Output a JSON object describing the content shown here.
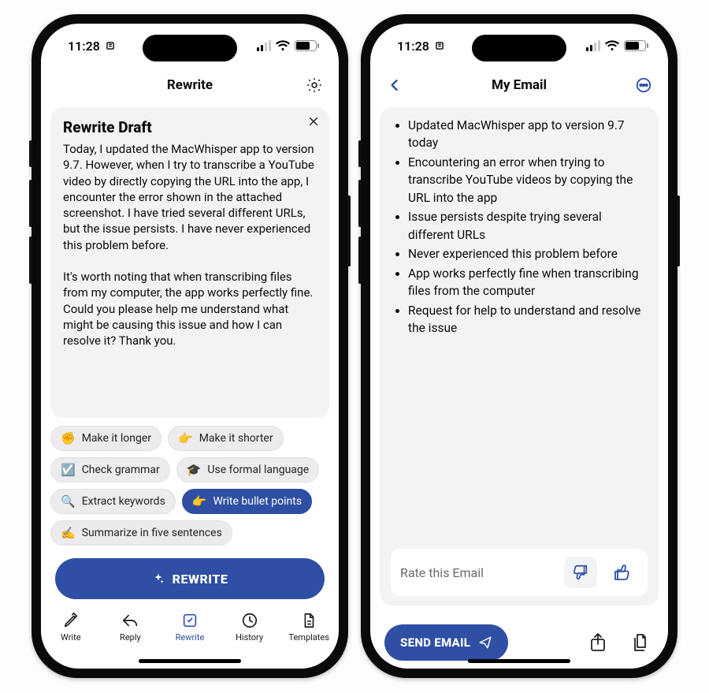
{
  "status": {
    "time": "11:28",
    "clock_icon": "⏱"
  },
  "left": {
    "nav_title": "Rewrite",
    "card_title": "Rewrite Draft",
    "draft_text": "Today, I updated the MacWhisper app to version 9.7. However, when I try to transcribe a YouTube video by directly copying the URL into the app, I encounter the error shown in the attached screenshot. I have tried several different URLs, but the issue persists. I have never experienced this problem before.\n\nIt's worth noting that when transcribing files from my computer, the app works perfectly fine. Could you please help me understand what might be causing this issue and how I can resolve it? Thank you.",
    "chips": [
      {
        "emoji": "✊",
        "label": "Make it longer",
        "selected": false
      },
      {
        "emoji": "👉",
        "label": "Make it shorter",
        "selected": false
      },
      {
        "emoji": "☑️",
        "label": "Check grammar",
        "selected": false
      },
      {
        "emoji": "🎓",
        "label": "Use formal language",
        "selected": false
      },
      {
        "emoji": "🔍",
        "label": "Extract keywords",
        "selected": false
      },
      {
        "emoji": "👉",
        "label": "Write bullet points",
        "selected": true
      },
      {
        "emoji": "✍️",
        "label": "Summarize in five sentences",
        "selected": false
      }
    ],
    "rewrite_button": "REWRITE",
    "tabs": [
      {
        "key": "write",
        "label": "Write",
        "active": false
      },
      {
        "key": "reply",
        "label": "Reply",
        "active": false
      },
      {
        "key": "rewrite",
        "label": "Rewrite",
        "active": true
      },
      {
        "key": "history",
        "label": "History",
        "active": false
      },
      {
        "key": "templates",
        "label": "Templates",
        "active": false
      }
    ]
  },
  "right": {
    "nav_title": "My Email",
    "bullets": [
      "Updated MacWhisper app to version 9.7 today",
      "Encountering an error when trying to transcribe YouTube videos by copying the URL into the app",
      "Issue persists despite trying several different URLs",
      "Never experienced this problem before",
      "App works perfectly fine when transcribing files from the computer",
      "Request for help to understand and resolve the issue"
    ],
    "rate_label": "Rate this Email",
    "send_button": "SEND EMAIL"
  }
}
